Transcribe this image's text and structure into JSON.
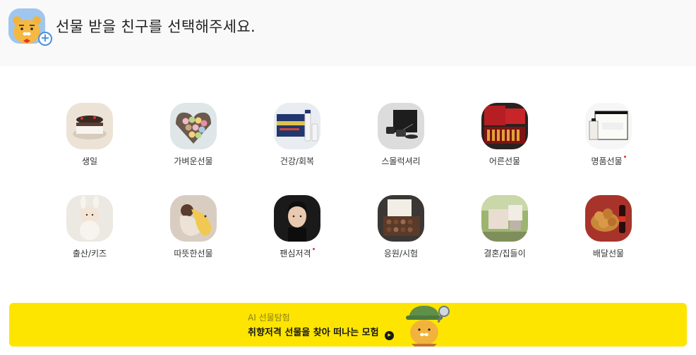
{
  "header": {
    "title": "선물 받을 친구를 선택해주세요.",
    "avatar_icon": "ryan-character-avatar",
    "add_icon": "plus-circle-icon"
  },
  "categories": [
    {
      "label": "생일",
      "icon": "birthday-cake-thumbnail",
      "new": false
    },
    {
      "label": "가벼운선물",
      "icon": "macaron-box-thumbnail",
      "new": false
    },
    {
      "label": "건강/회복",
      "icon": "health-supplement-thumbnail",
      "new": false
    },
    {
      "label": "스몰럭셔리",
      "icon": "luxury-accessory-thumbnail",
      "new": false
    },
    {
      "label": "어른선물",
      "icon": "red-gift-set-thumbnail",
      "new": false
    },
    {
      "label": "명품선물",
      "icon": "perfume-box-thumbnail",
      "new": true
    },
    {
      "label": "출산/키즈",
      "icon": "baby-thumbnail",
      "new": false
    },
    {
      "label": "따뜻한선물",
      "icon": "body-pillow-thumbnail",
      "new": false
    },
    {
      "label": "팬심저격",
      "icon": "celebrity-portrait-thumbnail",
      "new": true
    },
    {
      "label": "응원/시험",
      "icon": "chocolate-box-thumbnail",
      "new": false
    },
    {
      "label": "결혼/집들이",
      "icon": "home-appliance-thumbnail",
      "new": false
    },
    {
      "label": "배달선물",
      "icon": "fried-chicken-thumbnail",
      "new": false
    }
  ],
  "banner": {
    "subtitle": "AI 선물탐험",
    "title": "취향저격 선물을 찾아 떠나는 모험",
    "arrow_icon": "chevron-right-circle-icon",
    "character_icon": "explorer-ryan-character"
  },
  "colors": {
    "banner_bg": "#fee500",
    "header_bg": "#f9f9f9",
    "new_dot": "#e0323c",
    "accent_blue": "#4a8fe0"
  }
}
